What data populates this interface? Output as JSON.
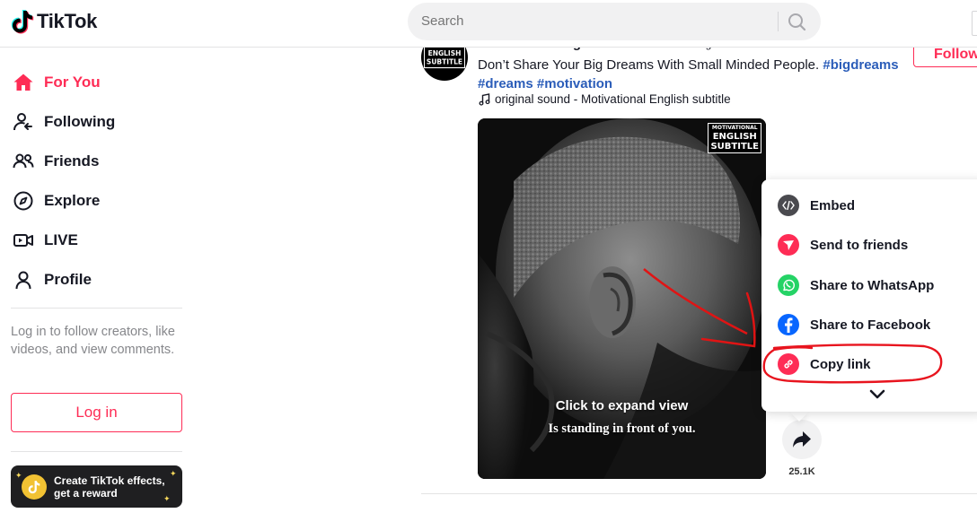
{
  "header": {
    "logo_text": "TikTok",
    "search_placeholder": "Search"
  },
  "sidebar": {
    "nav": [
      {
        "label": "For You",
        "icon": "home-icon",
        "active": true
      },
      {
        "label": "Following",
        "icon": "following-icon"
      },
      {
        "label": "Friends",
        "icon": "friends-icon"
      },
      {
        "label": "Explore",
        "icon": "compass-icon"
      },
      {
        "label": "LIVE",
        "icon": "live-icon"
      },
      {
        "label": "Profile",
        "icon": "profile-icon"
      }
    ],
    "login_prompt": "Log in to follow creators, like videos, and view comments.",
    "login_button": "Log in",
    "effects_banner": {
      "line1": "Create TikTok effects,",
      "line2": "get a reward"
    }
  },
  "post": {
    "author_username": "motivationalenglishsub",
    "author_nickname": "Motivational English subtitle",
    "description": "Don’t Share Your Big Dreams With Small Minded People.",
    "hashtags": [
      "#bigdreams",
      "#dreams",
      "#motivation"
    ],
    "sound": "original sound - Motivational English subtitle",
    "follow_label": "Follow",
    "avatar_text": {
      "line1": "ENGLISH",
      "line2": "SUBTITLE"
    },
    "video": {
      "watermark": {
        "top": "MOTIVATIONAL",
        "mid": "ENGLISH",
        "bottom": "SUBTITLE"
      },
      "expand_text": "Click to expand view",
      "caption": "Is standing in front of you."
    },
    "share_count": "25.1K"
  },
  "share_menu": {
    "items": [
      {
        "label": "Embed",
        "icon": "embed-icon",
        "color": "#4a4a4f"
      },
      {
        "label": "Send to friends",
        "icon": "send-icon",
        "color": "#fe2c55"
      },
      {
        "label": "Share to WhatsApp",
        "icon": "whatsapp-icon",
        "color": "#25d366"
      },
      {
        "label": "Share to Facebook",
        "icon": "facebook-icon",
        "color": "#0866ff"
      },
      {
        "label": "Copy link",
        "icon": "link-icon",
        "color": "#fe2c55"
      }
    ],
    "more_icon": "chevron-down-icon"
  },
  "colors": {
    "brand": "#fe2c55",
    "hashtag": "#2b5db9",
    "annotation": "#e8141e"
  }
}
